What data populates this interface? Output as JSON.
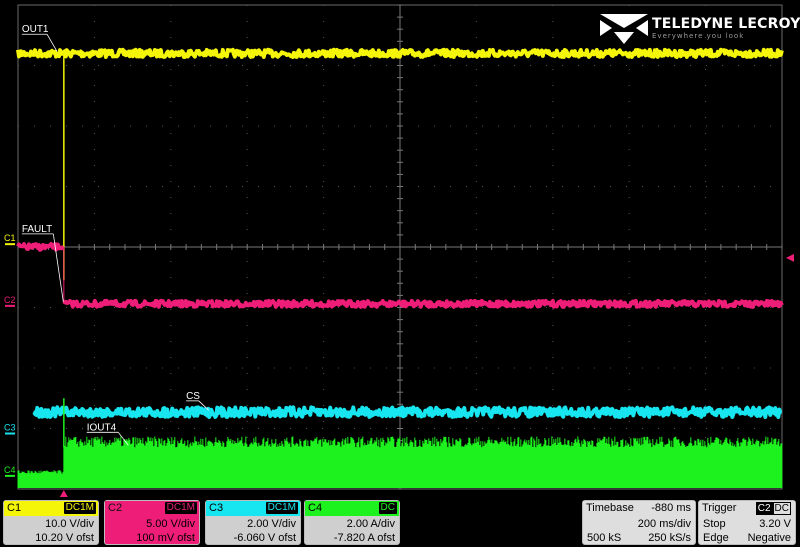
{
  "chart_data": {
    "type": "line",
    "grid": true,
    "divisions": {
      "x": 10,
      "y": 8
    },
    "trigger_time_div": 0.6,
    "x": [
      0,
      0.6,
      10
    ],
    "x_unit": "div",
    "series": [
      {
        "name": "OUT1",
        "channel": "C1",
        "color": "#f5f50a",
        "offset_div": 0,
        "x": [
          0,
          0.6,
          0.6,
          10
        ],
        "y": [
          7.2,
          7.2,
          7.2,
          7.2
        ],
        "noise": 0.06,
        "edge": {
          "x": 0.6,
          "from": 7.2,
          "to": 3.45
        }
      },
      {
        "name": "FAULT",
        "channel": "C2",
        "color": "#ee1e78",
        "offset_div": 0,
        "x": [
          0,
          0.6,
          0.6,
          10
        ],
        "y": [
          4.0,
          4.0,
          3.06,
          3.06
        ],
        "noise": 0.05
      },
      {
        "name": "CS",
        "channel": "C3",
        "color": "#17e6f0",
        "offset_div": 0,
        "x": [
          0,
          10
        ],
        "y": [
          1.27,
          1.27
        ],
        "noise": 0.08,
        "x_start": 0.2
      },
      {
        "name": "IOUT4",
        "channel": "C4",
        "color": "#1ef21e",
        "offset_div": 0,
        "x": [
          0,
          0.6,
          0.6,
          10
        ],
        "y": [
          0.25,
          0.25,
          0.69,
          0.69
        ],
        "noise": 0.18,
        "fill": true,
        "spike": {
          "x": 0.6,
          "y": 1.5
        }
      }
    ],
    "markers": [
      {
        "label": "C1",
        "y": 4.08,
        "color": "#f5f50a"
      },
      {
        "label": "C2",
        "y": 3.06,
        "color": "#ee1e78"
      },
      {
        "label": "C3",
        "y": 0.95,
        "color": "#17e6f0"
      },
      {
        "label": "C4",
        "y": 0.25,
        "color": "#1ef21e"
      }
    ],
    "trigger_level_marker": {
      "y": 3.82,
      "color": "#ee1e78"
    }
  },
  "logo": {
    "text": "TELEDYNE LECROY",
    "tagline": "Everywhere you look"
  },
  "panels": {
    "c1": {
      "name": "C1",
      "coupling": "DC1M",
      "scale": "10.0 V/div",
      "offset": "10.20 V ofst"
    },
    "c2": {
      "name": "C2",
      "coupling": "DC1M",
      "scale": "5.00 V/div",
      "offset": "100 mV ofst"
    },
    "c3": {
      "name": "C3",
      "coupling": "DC1M",
      "scale": "2.00 V/div",
      "offset": "-6.060 V ofst"
    },
    "c4": {
      "name": "C4",
      "coupling": "DC",
      "scale": "2.00 A/div",
      "offset": "-7.820 A ofst"
    },
    "timebase": {
      "label": "Timebase",
      "delay": "-880 ms",
      "scale": "200 ms/div",
      "samples": "500 kS",
      "rate": "250 kS/s"
    },
    "trigger": {
      "label": "Trigger",
      "source": "C2",
      "coupling": "DC",
      "mode": "Stop",
      "level": "3.20 V",
      "type": "Edge",
      "slope": "Negative"
    }
  }
}
